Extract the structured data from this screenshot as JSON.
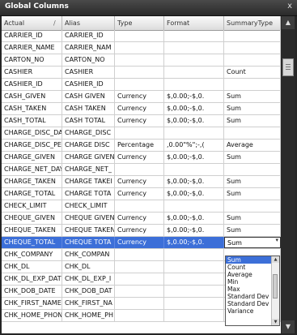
{
  "window": {
    "title": "Global Columns",
    "close": "x"
  },
  "columns": [
    "Actual",
    "Alias",
    "Type",
    "Format",
    "SummaryType"
  ],
  "sort_indicator": "/",
  "rows": [
    [
      "CARRIER_ID",
      "CARRIER_ID",
      "",
      "",
      ""
    ],
    [
      "CARRIER_NAME",
      "CARRIER_NAM",
      "",
      "",
      ""
    ],
    [
      "CARTON_NO",
      "CARTON_NO",
      "",
      "",
      ""
    ],
    [
      "CASHIER",
      "CASHIER",
      "",
      "",
      "Count"
    ],
    [
      "CASHIER_ID",
      "CASHIER_ID",
      "",
      "",
      ""
    ],
    [
      "CASH_GIVEN",
      "CASH GIVEN",
      "Currency",
      "$,0.00;-$,0.",
      "Sum"
    ],
    [
      "CASH_TAKEN",
      "CASH TAKEN",
      "Currency",
      "$,0.00;-$,0.",
      "Sum"
    ],
    [
      "CASH_TOTAL",
      "CASH TOTAL",
      "Currency",
      "$,0.00;-$,0.",
      "Sum"
    ],
    [
      "CHARGE_DISC_DA",
      "CHARGE_DISC",
      "",
      "",
      ""
    ],
    [
      "CHARGE_DISC_PE",
      "CHARGE DISC",
      "Percentage",
      ",0.00\"%\";-,(",
      "Average"
    ],
    [
      "CHARGE_GIVEN",
      "CHARGE GIVEN",
      "Currency",
      "$,0.00;-$,0.",
      "Sum"
    ],
    [
      "CHARGE_NET_DAY",
      "CHARGE_NET_",
      "",
      "",
      ""
    ],
    [
      "CHARGE_TAKEN",
      "CHARGE TAKEI",
      "Currency",
      "$,0.00;-$,0.",
      "Sum"
    ],
    [
      "CHARGE_TOTAL",
      "CHARGE TOTA",
      "Currency",
      "$,0.00;-$,0.",
      "Sum"
    ],
    [
      "CHECK_LIMIT",
      "CHECK_LIMIT",
      "",
      "",
      ""
    ],
    [
      "CHEQUE_GIVEN",
      "CHEQUE GIVEN",
      "Currency",
      "$,0.00;-$,0.",
      "Sum"
    ],
    [
      "CHEQUE_TAKEN",
      "CHEQUE TAKEN",
      "Currency",
      "$,0.00;-$,0.",
      "Sum"
    ],
    [
      "CHEQUE_TOTAL",
      "CHEQUE TOTA",
      "Currency",
      "$,0.00;-$,0.",
      "Sum"
    ],
    [
      "CHK_COMPANY",
      "CHK_COMPAN",
      "",
      "",
      ""
    ],
    [
      "CHK_DL",
      "CHK_DL",
      "",
      "",
      ""
    ],
    [
      "CHK_DL_EXP_DATI",
      "CHK_DL_EXP_I",
      "",
      "",
      ""
    ],
    [
      "CHK_DOB_DATE",
      "CHK_DOB_DAT",
      "",
      "",
      ""
    ],
    [
      "CHK_FIRST_NAME",
      "CHK_FIRST_NA",
      "",
      "",
      ""
    ],
    [
      "CHK_HOME_PHON",
      "CHK_HOME_PH",
      "",
      "",
      ""
    ]
  ],
  "selected_row_index": 17,
  "dropdown": {
    "options": [
      "Sum",
      "Count",
      "Average",
      "Min",
      "Max",
      "Standard Dev",
      "Standard Dev P",
      "Variance"
    ],
    "selected": "Sum"
  },
  "icons": {
    "close": "close-icon",
    "scroll_up": "scroll-up-icon",
    "scroll_down": "scroll-down-icon",
    "dropdown_arrow": "chevron-down-icon"
  },
  "colors": {
    "selection": "#3c6fd8",
    "titlebar": "#2a2a2a"
  }
}
